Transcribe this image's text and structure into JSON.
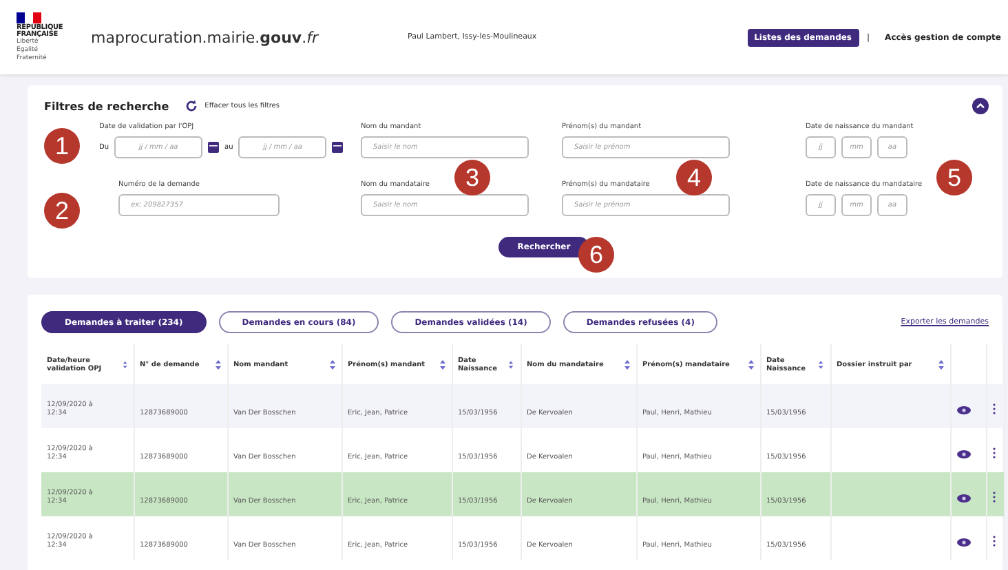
{
  "header": {
    "logo_lines": [
      "RÉPUBLIQUE",
      "FRANÇAISE"
    ],
    "motto": [
      "Liberté",
      "Égalité",
      "Fraternité"
    ],
    "site": "maprocuration.mairie.**gouv**.*fr*",
    "user": "Paul Lambert, Issy-les-Moulineaux",
    "nav": [
      {
        "label": "Listes des demandes",
        "selected": true
      },
      {
        "label": "Accès gestion de compte",
        "selected": false
      }
    ],
    "separator": "|"
  },
  "filters": {
    "title": "Filtres de recherche",
    "clear_label": "Effacer tous les filtres",
    "expanded": true,
    "fields": [
      {
        "kind": "daterange",
        "label": "Date de validation par l'OPJ",
        "from_prefix": "Du",
        "to_prefix": "au",
        "placeholders": [
          "jj / mm / aa",
          "jj / mm / aa"
        ]
      },
      {
        "kind": "text",
        "label": "Nom du mandant",
        "placeholder": "Saisir le nom"
      },
      {
        "kind": "text",
        "label": "Prénom(s) du mandant",
        "placeholder": "Saisir le prénom"
      },
      {
        "kind": "date3",
        "label": "Date de naissance du mandant",
        "placeholders": [
          "jj",
          "mm",
          "aa"
        ]
      },
      {
        "kind": "number",
        "label": "Numéro de la demande",
        "placeholder": "ex: 209827357"
      },
      {
        "kind": "text",
        "label": "Nom du mandataire",
        "placeholder": "Saisir le nom"
      },
      {
        "kind": "text",
        "label": "Prénom(s) du mandataire",
        "placeholder": "Saisir le prénom"
      },
      {
        "kind": "date3",
        "label": "Date de naissance du mandataire",
        "placeholders": [
          "jj",
          "mm",
          "aa"
        ]
      }
    ],
    "search_button": "Rechercher"
  },
  "annotations": [
    "1",
    "2",
    "3",
    "4",
    "5",
    "6"
  ],
  "tabs": [
    {
      "label": "Demandes à traiter (234)",
      "selected": true
    },
    {
      "label": "Demandes en cours (84)",
      "selected": false
    },
    {
      "label": "Demandes validées (14)",
      "selected": false
    },
    {
      "label": "Demandes refusées (4)",
      "selected": false
    }
  ],
  "export_link": "Exporter les demandes",
  "table": {
    "columns": [
      "Date/heure validation OPJ",
      "N° de demande",
      "Nom mandant",
      "Prénom(s) mandant",
      "Date Naissance",
      "Nom du mandataire",
      "Prénom(s) mandataire",
      "Date Naissance",
      "Dossier instruit par"
    ],
    "rows": [
      {
        "cells": [
          "12/09/2020 à 12:34",
          "12873689000",
          "Van Der Bosschen",
          "Eric, Jean, Patrice",
          "15/03/1956",
          "De Kervoalen",
          "Paul, Henri, Mathieu",
          "15/03/1956",
          ""
        ],
        "highlighted": false
      },
      {
        "cells": [
          "12/09/2020 à 12:34",
          "12873689000",
          "Van Der Bosschen",
          "Eric, Jean, Patrice",
          "15/03/1956",
          "De Kervoalen",
          "Paul, Henri, Mathieu",
          "15/03/1956",
          ""
        ],
        "highlighted": false
      },
      {
        "cells": [
          "12/09/2020 à 12:34",
          "12873689000",
          "Van Der Bosschen",
          "Eric, Jean, Patrice",
          "15/03/1956",
          "De Kervoalen",
          "Paul, Henri, Mathieu",
          "15/03/1956",
          ""
        ],
        "highlighted": true
      },
      {
        "cells": [
          "12/09/2020 à 12:34",
          "12873689000",
          "Van Der Bosschen",
          "Eric, Jean, Patrice",
          "15/03/1956",
          "De Kervoalen",
          "Paul, Henri, Mathieu",
          "15/03/1956",
          ""
        ],
        "highlighted": false
      }
    ]
  }
}
